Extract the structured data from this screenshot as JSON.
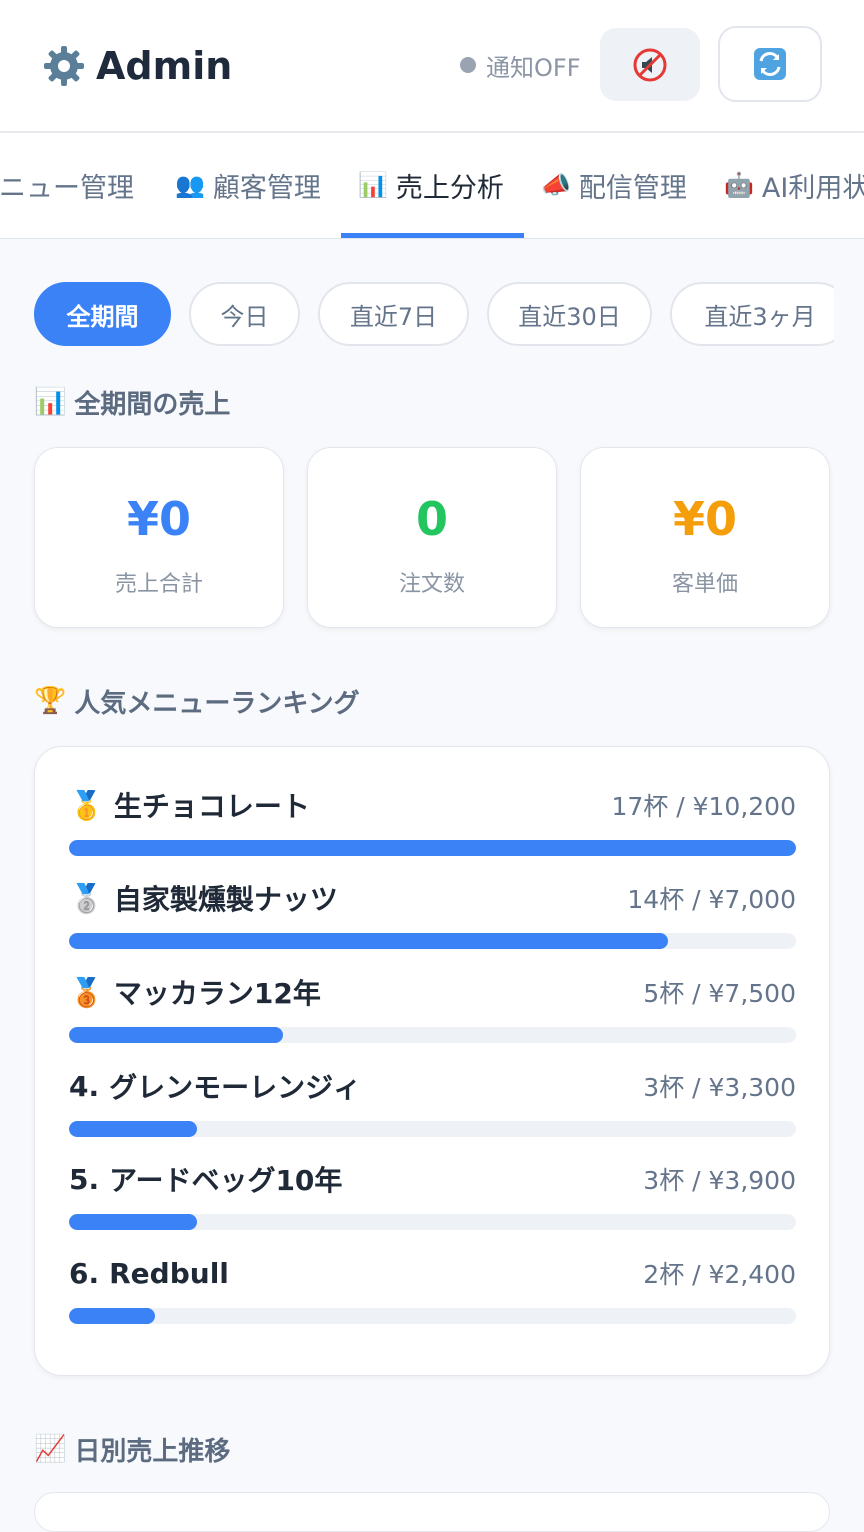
{
  "header": {
    "title": "Admin",
    "notification_status": "通知OFF"
  },
  "tabs": [
    {
      "label": "メニュー管理",
      "icon": "menu-icon"
    },
    {
      "label": "顧客管理",
      "icon": "users-icon"
    },
    {
      "label": "売上分析",
      "icon": "bar-chart-icon",
      "active": true
    },
    {
      "label": "配信管理",
      "icon": "megaphone-icon"
    },
    {
      "label": "AI利用状況",
      "icon": "robot-icon"
    }
  ],
  "periods": [
    "全期間",
    "今日",
    "直近7日",
    "直近30日",
    "直近3ヶ月"
  ],
  "active_period": "全期間",
  "sales_section": {
    "title": "全期間の売上",
    "stats": [
      {
        "value": "¥0",
        "label": "売上合計",
        "color": "#3b82f6"
      },
      {
        "value": "0",
        "label": "注文数",
        "color": "#22c55e"
      },
      {
        "value": "¥0",
        "label": "客単価",
        "color": "#f59e0b"
      }
    ]
  },
  "ranking_section": {
    "title": "人気メニューランキング",
    "items": [
      {
        "rank": "🥇",
        "name": "生チョコレート",
        "stat": "17杯 / ¥10,200",
        "cups": 17
      },
      {
        "rank": "🥈",
        "name": "自家製燻製ナッツ",
        "stat": "14杯 / ¥7,000",
        "cups": 14
      },
      {
        "rank": "🥉",
        "name": "マッカラン12年",
        "stat": "5杯 / ¥7,500",
        "cups": 5
      },
      {
        "rank": "4.",
        "name": "グレンモーレンジィ",
        "stat": "3杯 / ¥3,300",
        "cups": 3
      },
      {
        "rank": "5.",
        "name": "アードベッグ10年",
        "stat": "3杯 / ¥3,900",
        "cups": 3
      },
      {
        "rank": "6.",
        "name": "Redbull",
        "stat": "2杯 / ¥2,400",
        "cups": 2
      }
    ]
  },
  "daily_section": {
    "title": "日別売上推移"
  },
  "colors": {
    "accent": "#3b82f6",
    "green": "#22c55e",
    "amber": "#f59e0b"
  }
}
